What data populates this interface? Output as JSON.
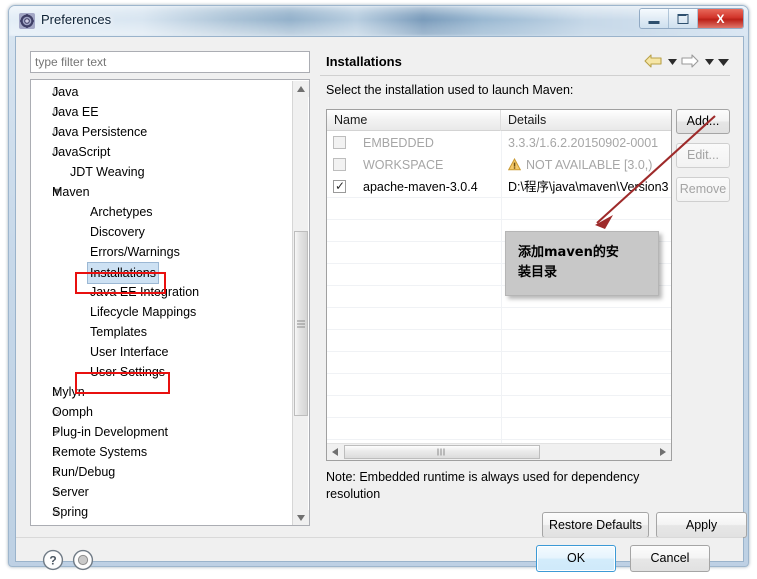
{
  "window": {
    "title": "Preferences",
    "icon": "preferences-gear-icon",
    "buttons": {
      "minimize": "minimize-icon",
      "maximize": "maximize-icon",
      "close": "X"
    }
  },
  "sidebar": {
    "filter": {
      "placeholder": "type filter text",
      "value": ""
    },
    "items": [
      {
        "label": "Java",
        "level": 0,
        "expandable": true,
        "expanded": false
      },
      {
        "label": "Java EE",
        "level": 0,
        "expandable": true,
        "expanded": false
      },
      {
        "label": "Java Persistence",
        "level": 0,
        "expandable": true,
        "expanded": false
      },
      {
        "label": "JavaScript",
        "level": 0,
        "expandable": true,
        "expanded": false
      },
      {
        "label": "JDT Weaving",
        "level": 0,
        "expandable": false,
        "expanded": false
      },
      {
        "label": "Maven",
        "level": 0,
        "expandable": true,
        "expanded": true
      },
      {
        "label": "Archetypes",
        "level": 1,
        "expandable": false,
        "expanded": false
      },
      {
        "label": "Discovery",
        "level": 1,
        "expandable": false,
        "expanded": false
      },
      {
        "label": "Errors/Warnings",
        "level": 1,
        "expandable": false,
        "expanded": false
      },
      {
        "label": "Installations",
        "level": 1,
        "expandable": false,
        "expanded": false,
        "selected": true,
        "highlighted": true
      },
      {
        "label": "Java EE Integration",
        "level": 1,
        "expandable": false,
        "expanded": false
      },
      {
        "label": "Lifecycle Mappings",
        "level": 1,
        "expandable": false,
        "expanded": false
      },
      {
        "label": "Templates",
        "level": 1,
        "expandable": false,
        "expanded": false
      },
      {
        "label": "User Interface",
        "level": 1,
        "expandable": false,
        "expanded": false
      },
      {
        "label": "User Settings",
        "level": 1,
        "expandable": false,
        "expanded": false,
        "highlighted": true
      },
      {
        "label": "Mylyn",
        "level": 0,
        "expandable": true,
        "expanded": false
      },
      {
        "label": "Oomph",
        "level": 0,
        "expandable": true,
        "expanded": false
      },
      {
        "label": "Plug-in Development",
        "level": 0,
        "expandable": true,
        "expanded": false
      },
      {
        "label": "Remote Systems",
        "level": 0,
        "expandable": true,
        "expanded": false
      },
      {
        "label": "Run/Debug",
        "level": 0,
        "expandable": true,
        "expanded": false
      },
      {
        "label": "Server",
        "level": 0,
        "expandable": true,
        "expanded": false
      },
      {
        "label": "Spring",
        "level": 0,
        "expandable": true,
        "expanded": false
      }
    ]
  },
  "panel": {
    "title": "Installations",
    "nav": {
      "back_icon": "back-arrow-icon",
      "back_caret_icon": "chevron-down-icon",
      "forward_icon": "forward-arrow-icon",
      "forward_caret_icon": "chevron-down-icon",
      "menu_caret_icon": "chevron-down-icon"
    },
    "instruction": "Select the installation used to launch Maven:",
    "table": {
      "columns": [
        "Name",
        "Details"
      ],
      "rows": [
        {
          "checked": false,
          "enabled": false,
          "name": "EMBEDDED",
          "details": "3.3.3/1.6.2.20150902-0001",
          "warning": false
        },
        {
          "checked": false,
          "enabled": false,
          "name": "WORKSPACE",
          "details": "NOT AVAILABLE [3.0,)",
          "warning": true
        },
        {
          "checked": true,
          "enabled": true,
          "name": "apache-maven-3.0.4",
          "details": "D:\\程序\\java\\maven\\Version3",
          "warning": false
        }
      ]
    },
    "buttons": {
      "add": "Add...",
      "edit": "Edit...",
      "remove": "Remove",
      "add_enabled": true,
      "edit_enabled": false,
      "remove_enabled": false
    },
    "note": "Note: Embedded runtime is always used for dependency resolution",
    "restore_defaults": "Restore Defaults",
    "apply": "Apply"
  },
  "footer": {
    "help_icon": "question-mark-icon",
    "secondary_icon": "circle-icon",
    "ok": "OK",
    "cancel": "Cancel"
  },
  "annotation": {
    "text_line1": "添加maven的安",
    "text_line2": "装目录",
    "arrow_color": "#9e2a2a",
    "box_color": "#c8c8c8"
  },
  "colors": {
    "selection_blue": "#cde1f3",
    "highlight_red": "#e8100f",
    "title_text": "#0d2135",
    "disabled_text": "#a6a6a6",
    "ok_border": "#3c9ad6"
  }
}
